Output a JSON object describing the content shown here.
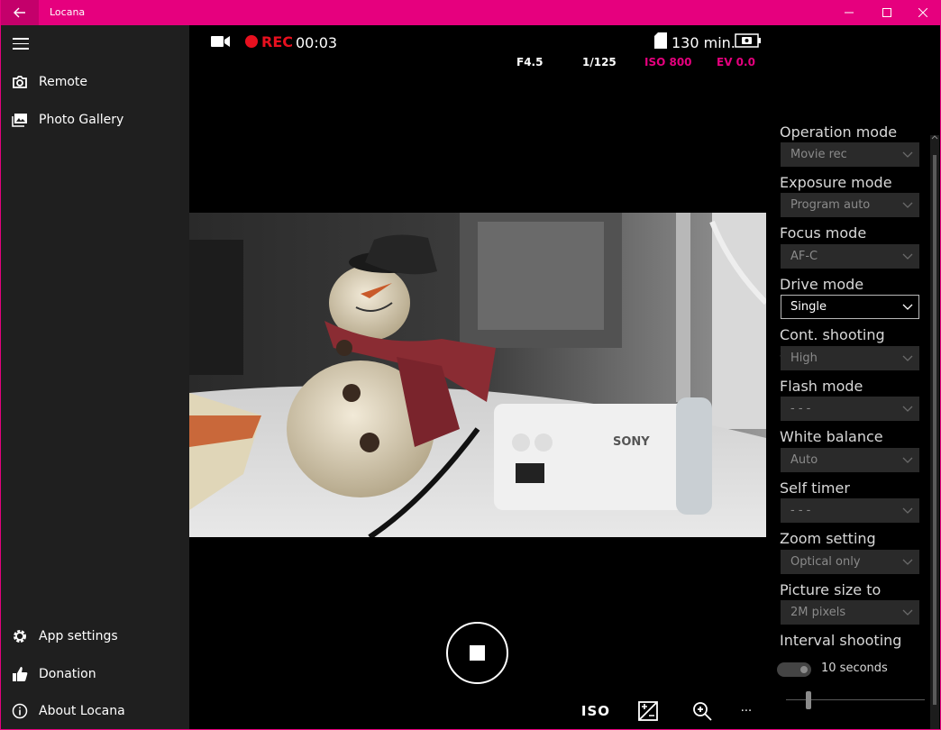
{
  "app": {
    "title": "Locana"
  },
  "sidebar": {
    "items": [
      {
        "label": "Remote",
        "icon": "camera-icon"
      },
      {
        "label": "Photo Gallery",
        "icon": "photos-icon"
      }
    ],
    "bottom_items": [
      {
        "label": "App settings",
        "icon": "gear-icon"
      },
      {
        "label": "Donation",
        "icon": "thumbs-up-icon"
      },
      {
        "label": "About Locana",
        "icon": "info-icon"
      }
    ]
  },
  "status": {
    "rec_label": "REC",
    "rec_time": "00:03",
    "remaining": "130 min.",
    "aperture": "F4.5",
    "shutter": "1/125",
    "iso": "ISO 800",
    "ev": "EV 0.0"
  },
  "toolbar": {
    "iso_label": "ISO",
    "more_label": "···"
  },
  "settings": {
    "operation_mode": {
      "label": "Operation mode",
      "value": "Movie rec"
    },
    "exposure_mode": {
      "label": "Exposure mode",
      "value": "Program auto"
    },
    "focus_mode": {
      "label": "Focus mode",
      "value": "AF-C"
    },
    "drive_mode": {
      "label": "Drive mode",
      "value": "Single"
    },
    "cont_speed": {
      "label": "Cont. shooting speed",
      "value": "High"
    },
    "flash_mode": {
      "label": "Flash mode",
      "value": "- - -"
    },
    "white_balance": {
      "label": "White balance",
      "value": "Auto"
    },
    "self_timer": {
      "label": "Self timer",
      "value": "- - -"
    },
    "zoom_setting": {
      "label": "Zoom setting",
      "value": "Optical only"
    },
    "picture_size": {
      "label": "Picture size to receive",
      "value": "2M pixels"
    },
    "interval": {
      "label": "Interval shooting",
      "value": "10 seconds"
    }
  },
  "liveview": {
    "brand_text": "SONY"
  },
  "colors": {
    "accent": "#e6007e",
    "rec": "#e8101f",
    "param_highlight": "#e6007e"
  }
}
